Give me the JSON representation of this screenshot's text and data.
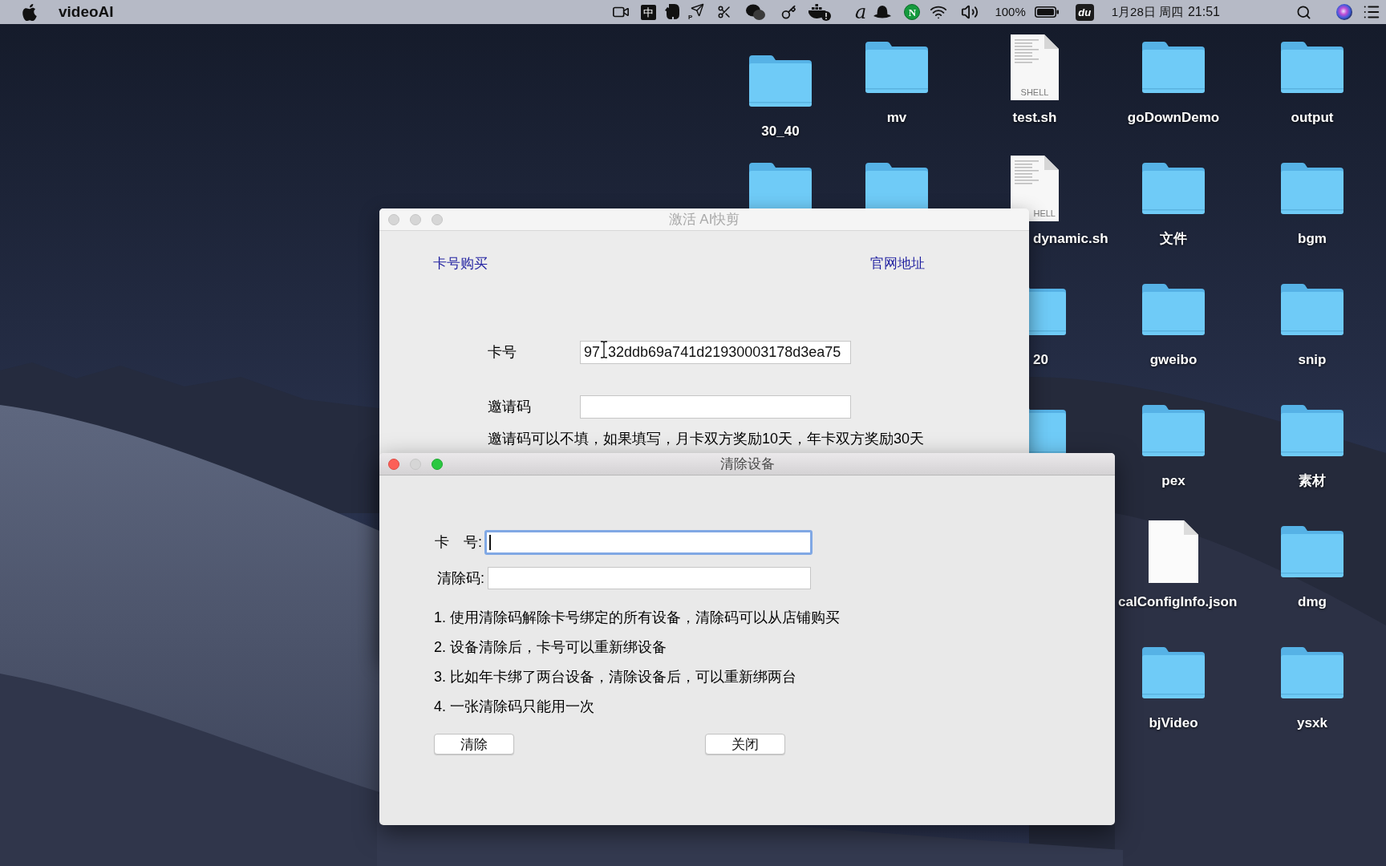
{
  "menu_bar": {
    "app_name": "videoAI",
    "input_method": "中",
    "send_badge": "P",
    "signature": "a",
    "n_badge": "N",
    "battery_percent": "100%",
    "tile_label": "du",
    "date": "1月28日 周四",
    "time": "21:51"
  },
  "desktop_items": [
    {
      "kind": "folder",
      "label": "30_40"
    },
    {
      "kind": "folder",
      "label": "mv"
    },
    {
      "kind": "script",
      "label": "test.sh",
      "badge": "SHELL"
    },
    {
      "kind": "folder",
      "label": "goDownDemo"
    },
    {
      "kind": "folder",
      "label": "output"
    },
    {
      "kind": "folder"
    },
    {
      "kind": "folder"
    },
    {
      "kind": "script",
      "label": "dynamic.sh",
      "badge": "HELL"
    },
    {
      "kind": "folder",
      "label": "文件"
    },
    {
      "kind": "folder",
      "label": "bgm"
    },
    {
      "kind": "folder",
      "label": "20"
    },
    {
      "kind": "folder",
      "label": "gweibo"
    },
    {
      "kind": "folder",
      "label": "snip"
    },
    {
      "kind": "folder"
    },
    {
      "kind": "folder",
      "label": "pex"
    },
    {
      "kind": "folder",
      "label": "素材"
    },
    {
      "kind": "document",
      "label": "calConfigInfo.json"
    },
    {
      "kind": "folder",
      "label": "dmg"
    },
    {
      "kind": "folder",
      "label": "bjVideo"
    },
    {
      "kind": "folder",
      "label": "ysxk"
    }
  ],
  "activation_window": {
    "title": "激活 AI快剪",
    "active": false,
    "links": [
      "卡号购买",
      "官网地址"
    ],
    "card_field": {
      "label": "卡号",
      "value_before_pointer": "97",
      "value_after_pointer": "32ddb69a741d21930003178d3ea75"
    },
    "invite_field": {
      "label": "邀请码"
    },
    "note": "邀请码可以不填，如果填写，月卡双方奖励10天，年卡双方奖励30天"
  },
  "clear_device_window": {
    "title": "清除设备",
    "active": true,
    "minimize_enabled": false,
    "fields": [
      {
        "label": "卡　号:",
        "focused": true
      },
      {
        "label": "清除码:",
        "focused": false
      }
    ],
    "instructions": [
      "1. 使用清除码解除卡号绑定的所有设备，清除码可以从店铺购买",
      "2. 设备清除后，卡号可以重新绑设备",
      "3. 比如年卡绑了两台设备，清除设备后，可以重新绑两台",
      "4. 一张清除码只能用一次"
    ],
    "buttons": [
      "清除",
      "关闭"
    ]
  }
}
